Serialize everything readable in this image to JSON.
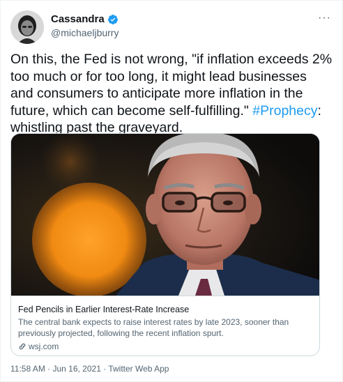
{
  "author": {
    "display_name": "Cassandra",
    "handle": "@michaeljburry"
  },
  "tweet": {
    "text_before": "On this, the Fed is not wrong, \"if inflation exceeds 2% too much or for too long, it might lead businesses and consumers to anticipate more inflation in the future, which can become self-fulfilling.\" ",
    "hashtag": "#Prophecy",
    "text_after": ": whistling past the graveyard."
  },
  "card": {
    "title": "Fed Pencils in Earlier Interest-Rate Increase",
    "description": "The central bank expects to raise interest rates by late 2023, sooner than previously projected, following the recent inflation spurt.",
    "domain": "wsj.com"
  },
  "meta": {
    "timestamp": "11:58 AM · Jun 16, 2021 · Twitter Web App"
  },
  "icons": {
    "verified": "verified-badge-icon",
    "more": "more-options-icon",
    "link": "link-icon"
  },
  "colors": {
    "accent": "#1d9bf0",
    "secondary_text": "#536471",
    "border": "#cfd9de"
  }
}
